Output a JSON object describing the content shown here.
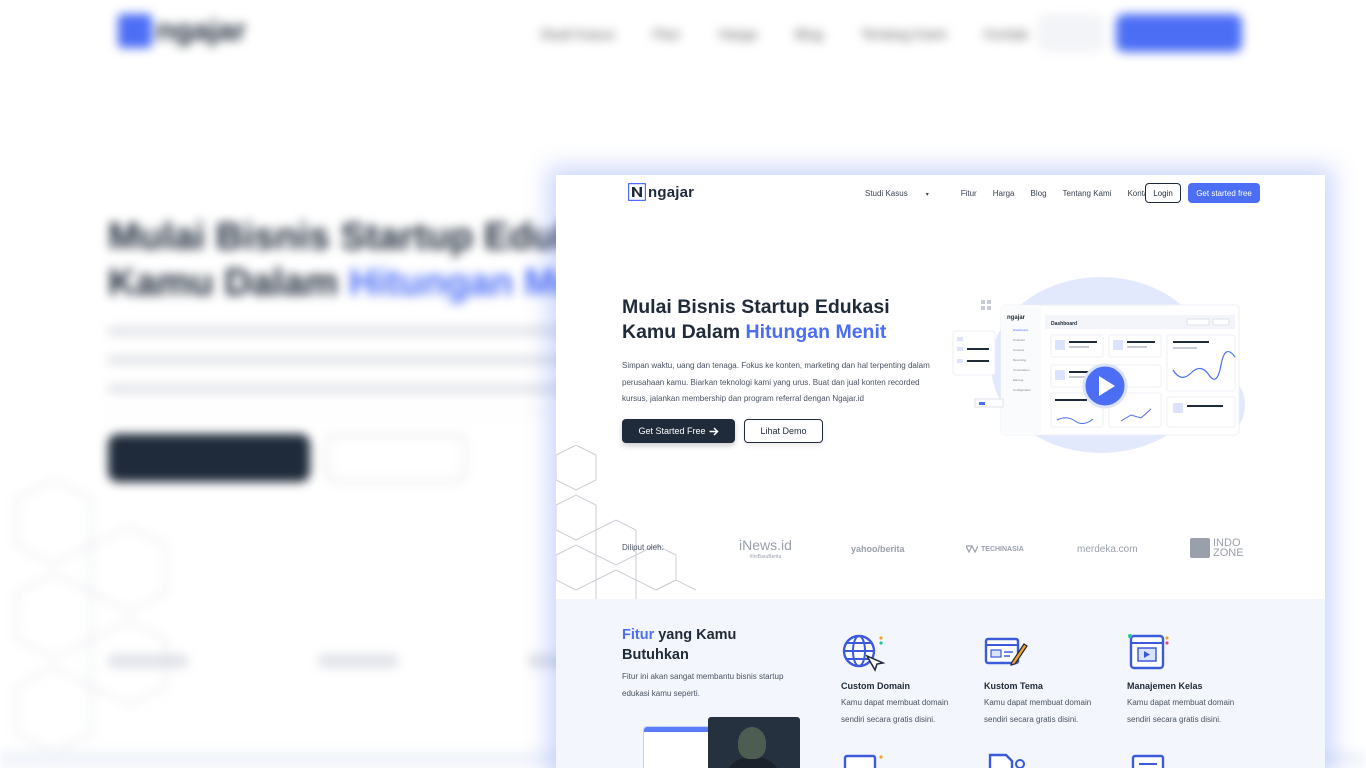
{
  "brand": {
    "name": "ngajar",
    "accent": "#4c6ef5",
    "dark": "#1f2a3a"
  },
  "nav": {
    "items": [
      "Studi Kasus",
      "Fitur",
      "Harga",
      "Blog",
      "Tentang Kami",
      "Kontak"
    ],
    "caret": "▾",
    "login": "Login",
    "cta": "Get started free"
  },
  "hero": {
    "title_line1": "Mulai Bisnis Startup Edukasi",
    "title_line2_plain": "Kamu Dalam ",
    "title_line2_accent": "Hitungan Menit",
    "description": "Simpan waktu, uang dan tenaga. Fokus ke konten, marketing dan hal terpenting dalam perusahaan kamu. Biarkan teknologi kami yang urus. Buat dan jual konten recorded kursus, jalankan membership dan program referral dengan Ngajar.id",
    "primary_button": "Get Started Free",
    "secondary_button": "Lihat Demo",
    "illustration": {
      "logo": "ngajar",
      "panel_title": "Dashboard",
      "menu_items": [
        "Dashboard",
        "Products",
        "Courses",
        "Recurring",
        "Commission",
        "Earning",
        "Configuration"
      ]
    }
  },
  "press": {
    "label": "Diliput oleh:",
    "outlets": {
      "inews": "iNews.id",
      "inews_tag": "#IniBaruBerita",
      "yahoo": "yahoo/berita",
      "techinasia": "TECHINASIA",
      "merdeka": "merdeka.com",
      "indozone_1": "INDO",
      "indozone_2": "ZONE"
    }
  },
  "features": {
    "title_accent": "Fitur",
    "title_rest": " yang Kamu Butuhkan",
    "description": "Fitur ini akan sangat membantu bisnis startup edukasi kamu seperti.",
    "items": [
      {
        "name": "Custom Domain",
        "text": "Kamu dapat membuat domain sendiri secara gratis disini.",
        "icon": "globe-icon"
      },
      {
        "name": "Kustom Tema",
        "text": "Kamu dapat membuat domain sendiri secara gratis disini.",
        "icon": "theme-icon"
      },
      {
        "name": "Manajemen Kelas",
        "text": "Kamu dapat membuat domain sendiri secara gratis disini.",
        "icon": "class-icon"
      }
    ]
  },
  "background_page": {
    "title_line1": "Mulai Bisnis Startup Edukasi",
    "title_line2_plain": "Kamu Dalam ",
    "title_line2_accent": "Hitungan Menit",
    "logo": "ngajar"
  }
}
